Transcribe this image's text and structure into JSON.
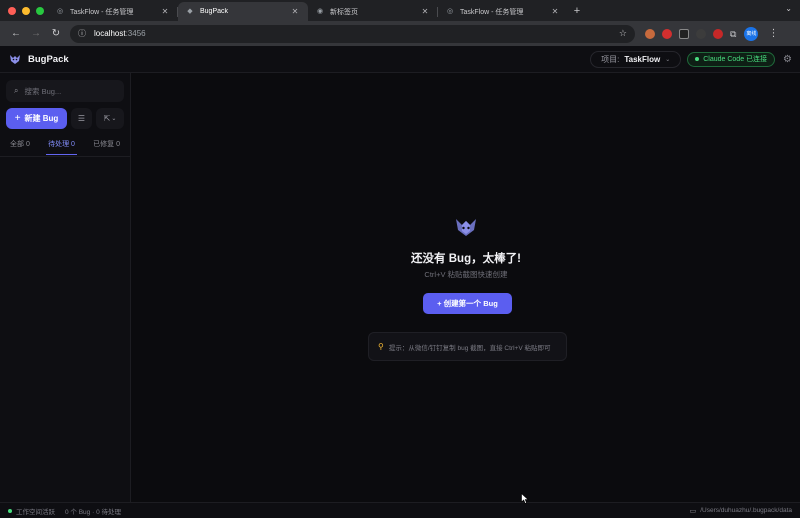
{
  "browser": {
    "tabs": [
      {
        "title": "TaskFlow - 任务管理",
        "active": false
      },
      {
        "title": "BugPack",
        "active": true
      },
      {
        "title": "新标签页",
        "active": false
      },
      {
        "title": "TaskFlow - 任务管理",
        "active": false
      }
    ],
    "url_host": "localhost",
    "url_port": ":3456",
    "profile_label": "离线"
  },
  "header": {
    "brand": "BugPack",
    "project_label": "项目:",
    "project_name": "TaskFlow",
    "connection": "Claude Code 已连接"
  },
  "sidebar": {
    "search_placeholder": "搜索 Bug...",
    "new_bug_label": "新建 Bug",
    "filters": [
      {
        "label": "全部 0",
        "active": false
      },
      {
        "label": "待处理 0",
        "active": true
      },
      {
        "label": "已修复 0",
        "active": false
      }
    ]
  },
  "main": {
    "empty_title": "还没有 Bug，太棒了!",
    "empty_subtitle": "Ctrl+V 粘贴截图快速创建",
    "cta_label": "+ 创建第一个 Bug",
    "tip": "提示：从微信/钉钉复制 bug 截图，直接 Ctrl+V 粘贴即可"
  },
  "statusbar": {
    "workspace": "工作空间活跃",
    "bug_count": "0 个 Bug · 0 待处理",
    "path": "/Users/duhuazhu/.bugpack/data"
  },
  "colors": {
    "accent": "#5b5ef0",
    "connected": "#4ade80",
    "tip_bulb": "#f5b833"
  }
}
